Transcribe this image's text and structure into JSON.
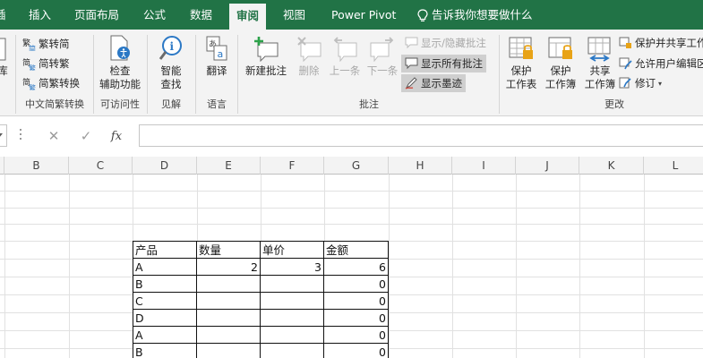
{
  "tabs": [
    {
      "label": "插入",
      "active": false
    },
    {
      "label": "页面布局",
      "active": false
    },
    {
      "label": "公式",
      "active": false
    },
    {
      "label": "数据",
      "active": false
    },
    {
      "label": "审阅",
      "active": true
    },
    {
      "label": "视图",
      "active": false
    },
    {
      "label": "Power Pivot",
      "active": false
    }
  ],
  "tab_edge": "插",
  "tell_me": "告诉我你想要做什么",
  "colors": {
    "accent": "#217346",
    "ribbon_bg": "#f3f3f3",
    "header_bg": "#f3f3f3",
    "highlight": "#cfcfcf"
  },
  "ribbon": {
    "proofing_edge": "库",
    "chinese": {
      "label": "中文简繁转换",
      "items": [
        {
          "label": "繁转简",
          "icon": "trad-to-simp-icon"
        },
        {
          "label": "简转繁",
          "icon": "simp-to-trad-icon"
        },
        {
          "label": "简繁转换",
          "icon": "convert-icon"
        }
      ]
    },
    "accessibility": {
      "label": "可访问性",
      "button_line1": "检查",
      "button_line2": "辅助功能"
    },
    "insights": {
      "label": "见解",
      "button_line1": "智能",
      "button_line2": "查找"
    },
    "language": {
      "label": "语言",
      "button": "翻译"
    },
    "comments": {
      "label": "批注",
      "new": "新建批注",
      "delete": "删除",
      "prev": "上一条",
      "next": "下一条",
      "show_hide": "显示/隐藏批注",
      "show_all": "显示所有批注",
      "show_ink": "显示墨迹"
    },
    "changes": {
      "label": "更改",
      "protect_sheet_1": "保护",
      "protect_sheet_2": "工作表",
      "protect_book_1": "保护",
      "protect_book_2": "工作簿",
      "share_book_1": "共享",
      "share_book_2": "工作簿",
      "protect_share": "保护并共享工作",
      "allow_edit": "允许用户编辑区",
      "track": "修订"
    }
  },
  "formula_bar": {
    "cancel": "✕",
    "enter": "✓",
    "fx": "fx",
    "value": ""
  },
  "columns": [
    "B",
    "C",
    "D",
    "E",
    "F",
    "G",
    "H",
    "I",
    "J",
    "K",
    "L"
  ],
  "table": {
    "headers": [
      "产品",
      "数量",
      "单价",
      "金额"
    ],
    "rows": [
      [
        "A",
        "2",
        "3",
        "6"
      ],
      [
        "B",
        "",
        "",
        "0"
      ],
      [
        "C",
        "",
        "",
        "0"
      ],
      [
        "D",
        "",
        "",
        "0"
      ],
      [
        "A",
        "",
        "",
        "0"
      ],
      [
        "B",
        "",
        "",
        "0"
      ]
    ]
  }
}
